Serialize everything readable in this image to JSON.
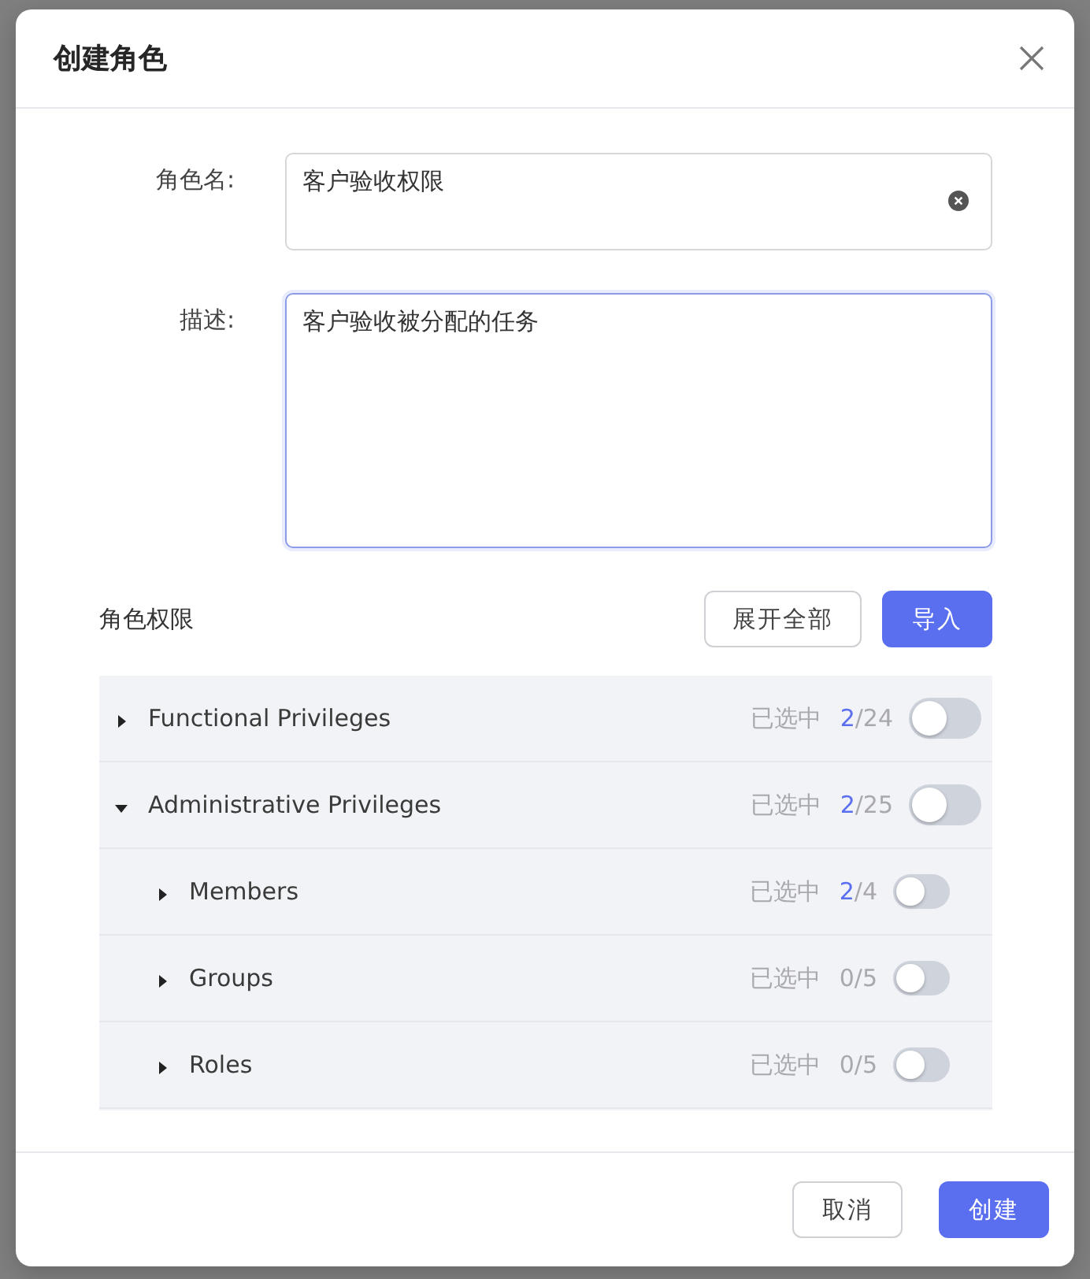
{
  "dialog": {
    "title": "创建角色"
  },
  "form": {
    "name": {
      "label": "角色名:",
      "value": "客户验收权限",
      "focused": false
    },
    "description": {
      "label": "描述:",
      "value": "客户验收被分配的任务",
      "focused": true
    }
  },
  "permissions": {
    "title": "角色权限",
    "buttons": [
      {
        "label": "展开全部",
        "kind": "secondary"
      },
      {
        "label": "导入",
        "kind": "primary"
      }
    ],
    "tree": [
      {
        "name": "Functional Privileges",
        "status_label": "已选中",
        "count": "2",
        "total": "/24",
        "highlight": true,
        "expanded": false,
        "on": false
      },
      {
        "name": "Administrative Privileges",
        "status_label": "已选中",
        "count": "2",
        "total": "/25",
        "highlight": true,
        "expanded": true,
        "on": false,
        "children": [
          {
            "name": "Members",
            "status_label": "已选中",
            "count": "2",
            "total": "/4",
            "highlight": true,
            "expanded": false,
            "on": false
          },
          {
            "name": "Groups",
            "status_label": "已选中",
            "count": "0",
            "total": "/5",
            "highlight": false,
            "expanded": false,
            "on": false
          },
          {
            "name": "Roles",
            "status_label": "已选中",
            "count": "0",
            "total": "/5",
            "highlight": false,
            "expanded": false,
            "on": false
          }
        ]
      }
    ]
  },
  "footer": {
    "buttons": [
      {
        "label": "取消",
        "kind": "secondary"
      },
      {
        "label": "创建",
        "kind": "primary"
      }
    ]
  }
}
